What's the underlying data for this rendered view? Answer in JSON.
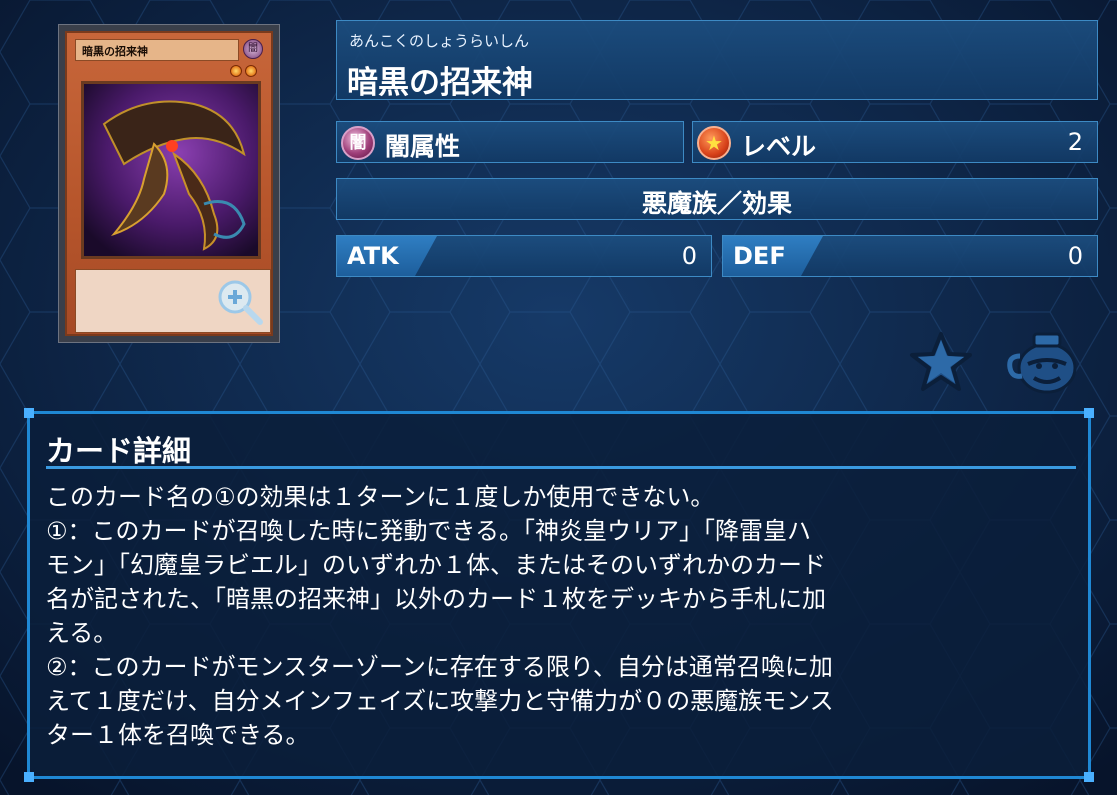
{
  "card": {
    "reading": "あんこくのしょうらいしん",
    "name": "暗黒の招来神",
    "attribute": "闇属性",
    "attribute_glyph": "闇",
    "level_label": "レベル",
    "level_value": "2",
    "type_line": "悪魔族／効果",
    "atk_label": "ATK",
    "atk_value": "0",
    "def_label": "DEF",
    "def_value": "0",
    "level_stars": 2
  },
  "card_image": {
    "name_text": "暗黒の招来神",
    "attribute_glyph": "闇",
    "frame_color": "#c7663a"
  },
  "icons": {
    "zoom": "zoom-in-icon",
    "favorite": "star-icon",
    "pot": "pot-of-greed-icon"
  },
  "detail": {
    "title": "カード詳細",
    "text": "このカード名の①の効果は１ターンに１度しか使用できない。\n①：このカードが召喚した時に発動できる。「神炎皇ウリア」「降雷皇ハ\nモン」「幻魔皇ラビエル」のいずれか１体、またはそのいずれかのカード\n名が記された、「暗黒の招来神」以外のカード１枚をデッキから手札に加\nえる。\n②：このカードがモンスターゾーンに存在する限り、自分は通常召喚に加\nえて１度だけ、自分メインフェイズに攻撃力と守備力が０の悪魔族モンス\nター１体を召喚できる。"
  },
  "colors": {
    "background": "#0a1a35",
    "panel": "#1c4e80",
    "accent": "#1f88d4"
  }
}
